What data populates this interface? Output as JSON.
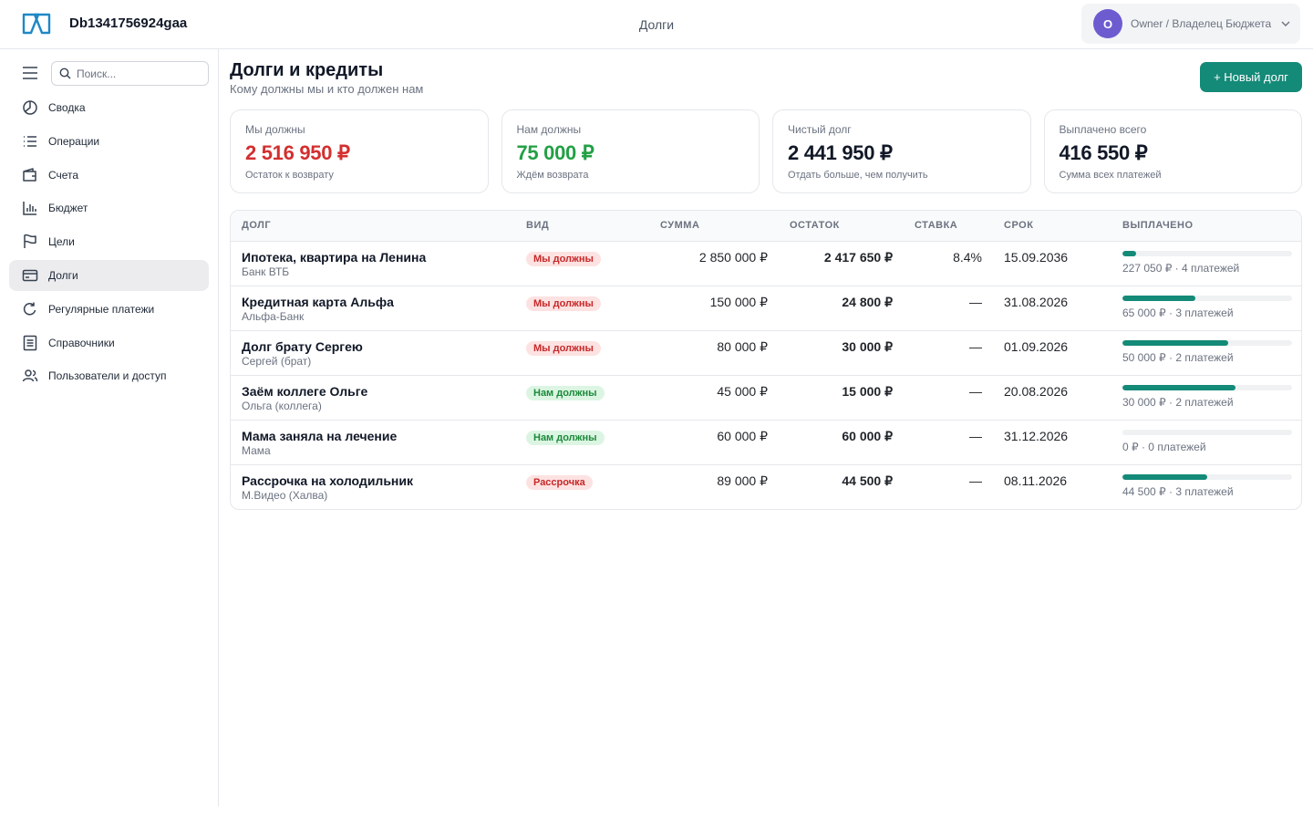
{
  "app": {
    "title": "Db1341756924gaa"
  },
  "header": {
    "current_page": "Долги"
  },
  "user": {
    "avatar_letter": "O",
    "role": "Owner / Владелец Бюджета"
  },
  "sidebar": {
    "search_placeholder": "Поиск...",
    "items": [
      {
        "label": "Сводка",
        "icon": "clock-pie-icon",
        "active": false
      },
      {
        "label": "Операции",
        "icon": "list-icon",
        "active": false
      },
      {
        "label": "Счета",
        "icon": "wallet-icon",
        "active": false
      },
      {
        "label": "Бюджет",
        "icon": "bar-chart-icon",
        "active": false
      },
      {
        "label": "Цели",
        "icon": "flag-icon",
        "active": false
      },
      {
        "label": "Долги",
        "icon": "credit-card-icon",
        "active": true
      },
      {
        "label": "Регулярные платежи",
        "icon": "refresh-icon",
        "active": false
      },
      {
        "label": "Справочники",
        "icon": "document-icon",
        "active": false
      },
      {
        "label": "Пользователи и доступ",
        "icon": "users-icon",
        "active": false
      }
    ]
  },
  "page": {
    "title": "Долги и кредиты",
    "subtitle": "Кому должны мы и кто должен нам",
    "new_button": "+ Новый долг"
  },
  "summary": [
    {
      "label": "Мы должны",
      "value": "2 516 950 ₽",
      "caption": "Остаток к возврату",
      "color": "#d32f2f"
    },
    {
      "label": "Нам должны",
      "value": "75 000 ₽",
      "caption": "Ждём возврата",
      "color": "#22a045"
    },
    {
      "label": "Чистый долг",
      "value": "2 441 950 ₽",
      "caption": "Отдать больше, чем получить",
      "color": "#111827"
    },
    {
      "label": "Выплачено всего",
      "value": "416 550 ₽",
      "caption": "Сумма всех платежей",
      "color": "#111827"
    }
  ],
  "table": {
    "headers": [
      "ДОЛГ",
      "ВИД",
      "СУММА",
      "ОСТАТОК",
      "СТАВКА",
      "СРОК",
      "ВЫПЛАЧЕНО"
    ],
    "rows": [
      {
        "name": "Ипотека, квартира на Ленина",
        "party": "Банк ВТБ",
        "kind": "Мы должны",
        "kind_type": "owe",
        "amount": "2 850 000 ₽",
        "balance": "2 417 650 ₽",
        "rate": "8.4%",
        "due": "15.09.2036",
        "paid_text": "227 050 ₽ · 4 платежей",
        "paid_fraction": 0.08
      },
      {
        "name": "Кредитная карта Альфа",
        "party": "Альфа-Банк",
        "kind": "Мы должны",
        "kind_type": "owe",
        "amount": "150 000 ₽",
        "balance": "24 800 ₽",
        "rate": "—",
        "due": "31.08.2026",
        "paid_text": "65 000 ₽ · 3 платежей",
        "paid_fraction": 0.43
      },
      {
        "name": "Долг брату Сергею",
        "party": "Сергей (брат)",
        "kind": "Мы должны",
        "kind_type": "owe",
        "amount": "80 000 ₽",
        "balance": "30 000 ₽",
        "rate": "—",
        "due": "01.09.2026",
        "paid_text": "50 000 ₽ · 2 платежей",
        "paid_fraction": 0.625
      },
      {
        "name": "Заём коллеге Ольге",
        "party": "Ольга (коллега)",
        "kind": "Нам должны",
        "kind_type": "owed",
        "amount": "45 000 ₽",
        "balance": "15 000 ₽",
        "rate": "—",
        "due": "20.08.2026",
        "paid_text": "30 000 ₽ · 2 платежей",
        "paid_fraction": 0.667
      },
      {
        "name": "Мама заняла на лечение",
        "party": "Мама",
        "kind": "Нам должны",
        "kind_type": "owed",
        "amount": "60 000 ₽",
        "balance": "60 000 ₽",
        "rate": "—",
        "due": "31.12.2026",
        "paid_text": "0 ₽ · 0 платежей",
        "paid_fraction": 0
      },
      {
        "name": "Рассрочка на холодильник",
        "party": "М.Видео (Халва)",
        "kind": "Рассрочка",
        "kind_type": "owe",
        "amount": "89 000 ₽",
        "balance": "44 500 ₽",
        "rate": "—",
        "due": "08.11.2026",
        "paid_text": "44 500 ₽ · 3 платежей",
        "paid_fraction": 0.5
      }
    ]
  },
  "colors": {
    "accent": "#148a78",
    "avatar": "#6d5bd0",
    "negative": "#d32f2f",
    "positive": "#22a045"
  }
}
